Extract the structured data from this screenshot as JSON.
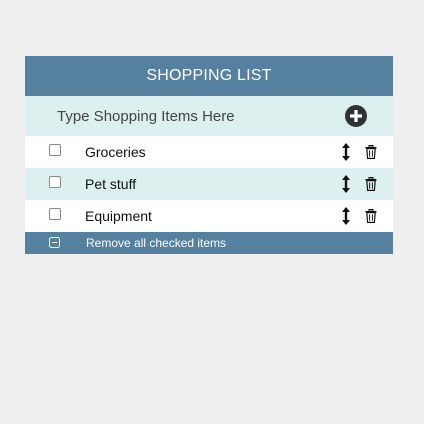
{
  "header": {
    "title": "SHOPPING LIST"
  },
  "input": {
    "placeholder": "Type Shopping Items Here",
    "value": ""
  },
  "add_button": {
    "icon": "plus-circle-icon"
  },
  "items": [
    {
      "label": "Groceries",
      "checked": false
    },
    {
      "label": "Pet stuff",
      "checked": false
    },
    {
      "label": "Equipment",
      "checked": false
    }
  ],
  "footer": {
    "remove_label": "Remove all checked items",
    "icon": "minus-square-icon"
  },
  "colors": {
    "header_bg": "#55809f",
    "row_alt_bg": "#dcf0ef",
    "page_bg": "#efefef"
  }
}
